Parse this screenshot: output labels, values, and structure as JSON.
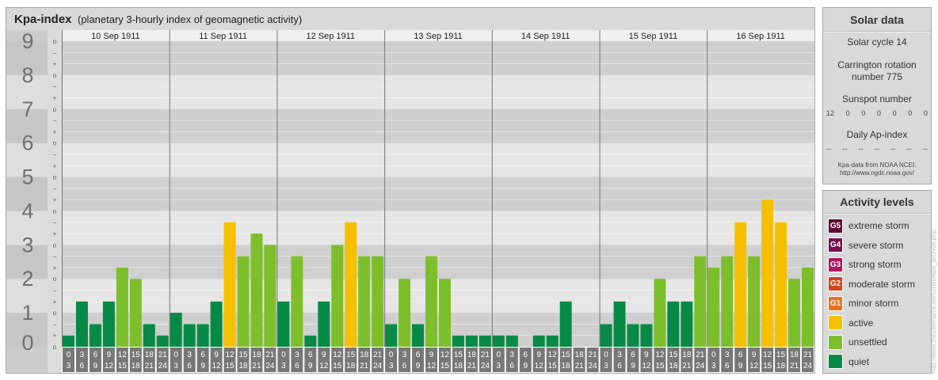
{
  "title": {
    "main": "Kpa-index",
    "sub": "(planetary 3-hourly index of geomagnetic activity)"
  },
  "chart_data": {
    "type": "bar",
    "title": "Kpa-index",
    "subtitle": "(planetary 3-hourly index of geomagnetic activity)",
    "ylim": [
      0,
      9
    ],
    "y_ticks": [
      "0",
      "1",
      "2",
      "3",
      "4",
      "5",
      "6",
      "7",
      "8",
      "9"
    ],
    "minor_ticks": [
      "+",
      "o",
      "–"
    ],
    "days": [
      "10 Sep 1911",
      "11 Sep 1911",
      "12 Sep 1911",
      "13 Sep 1911",
      "14 Sep 1911",
      "15 Sep 1911",
      "16 Sep 1911"
    ],
    "intervals": [
      [
        "0",
        "3"
      ],
      [
        "3",
        "6"
      ],
      [
        "6",
        "9"
      ],
      [
        "9",
        "12"
      ],
      [
        "12",
        "15"
      ],
      [
        "15",
        "18"
      ],
      [
        "18",
        "21"
      ],
      [
        "21",
        "24"
      ]
    ],
    "values": [
      [
        0.333,
        1.333,
        0.667,
        1.333,
        2.333,
        2.0,
        0.667,
        0.333
      ],
      [
        1.0,
        0.667,
        0.667,
        1.333,
        3.667,
        2.667,
        3.333,
        3.0
      ],
      [
        1.333,
        2.667,
        0.333,
        1.333,
        3.0,
        3.667,
        2.667,
        2.667
      ],
      [
        0.667,
        2.0,
        0.667,
        2.667,
        2.0,
        0.333,
        0.333,
        0.333
      ],
      [
        0.333,
        0.333,
        0.0,
        0.333,
        0.333,
        1.333,
        0.0,
        0.0
      ],
      [
        0.667,
        1.333,
        0.667,
        0.667,
        2.0,
        1.333,
        1.333,
        2.667
      ],
      [
        2.333,
        2.667,
        3.667,
        2.667,
        4.333,
        3.667,
        2.0,
        2.333
      ]
    ]
  },
  "solar": {
    "title": "Solar data",
    "cycle": "Solar cycle 14",
    "carrington_1": "Carrington rotation",
    "carrington_2": "number 775",
    "sunspot_label": "Sunspot number",
    "sunspot_values": [
      "12",
      "0",
      "0",
      "0",
      "0",
      "0",
      "0"
    ],
    "ap_label": "Daily Ap-index",
    "ap_values": [
      "--",
      "--",
      "--",
      "--",
      "--",
      "--",
      "--"
    ],
    "source_1": "Kpa-data from NOAA NCEI:",
    "source_2": "http://www.ngdc.noaa.gov/"
  },
  "activity": {
    "title": "Activity levels",
    "levels": [
      {
        "code": "G5",
        "label": "extreme storm",
        "color": "#5c0a2e"
      },
      {
        "code": "G4",
        "label": "severe storm",
        "color": "#7a0f4e"
      },
      {
        "code": "G3",
        "label": "strong storm",
        "color": "#b01561"
      },
      {
        "code": "G2",
        "label": "moderate storm",
        "color": "#d2451e"
      },
      {
        "code": "G1",
        "label": "minor storm",
        "color": "#e8731c"
      },
      {
        "code": "",
        "label": "active",
        "color": "#f5c000"
      },
      {
        "code": "",
        "label": "unsettled",
        "color": "#7dbf2a"
      },
      {
        "code": "",
        "label": "quiet",
        "color": "#068a45"
      }
    ]
  },
  "colors": {
    "quiet": "#068a45",
    "unsettled": "#7dbf2a",
    "active": "#f5c000"
  },
  "watermark": "http://www.theusername.de/sonne/kpa_archive.php"
}
